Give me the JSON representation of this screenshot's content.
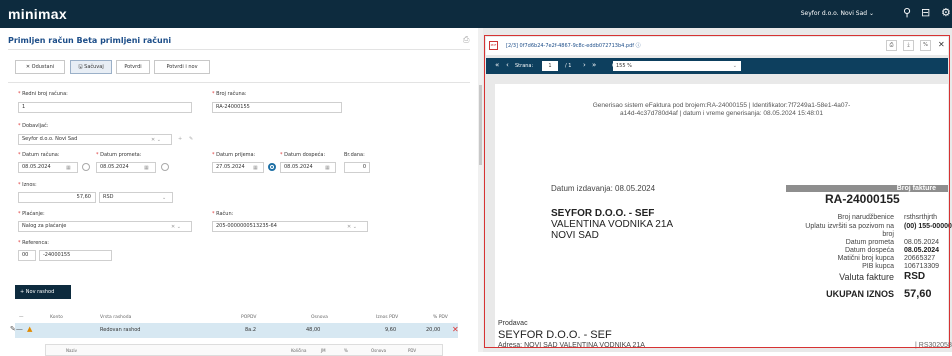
{
  "topbar": {
    "logo": "minimax",
    "company": "Seyfor d.o.o. Novi Sad ⌄"
  },
  "page": {
    "title": "Primljen račun Beta primljeni računi"
  },
  "toolbar": {
    "cancel": "Odustani",
    "save": "Sačuvaj",
    "confirm": "Potvrdi",
    "confirm_new": "Potvrdi i nov"
  },
  "form": {
    "redni_broj_label": "Redni broj računa:",
    "redni_broj": "1",
    "broj_racuna_label": "Broj računa:",
    "broj_racuna": "RA-24000155",
    "dobavljac_label": "Dobavljač:",
    "dobavljac": "Seyfor d.o.o. Novi Sad",
    "datum_racuna_label": "Datum računa:",
    "datum_racuna": "08.05.2024",
    "datum_prometa_label": "Datum prometa:",
    "datum_prometa": "08.05.2024",
    "datum_prijema_label": "Datum prijema:",
    "datum_prijema": "27.05.2024",
    "datum_dospeca_label": "Datum dospeća:",
    "datum_dospeca": "08.05.2024",
    "br_dana_label": "Br.dana:",
    "br_dana": "0",
    "iznos_label": "Iznos:",
    "iznos": "57,60",
    "valuta": "RSD",
    "placanje_label": "Plaćanje:",
    "placanje": "Nalog za plaćanje",
    "racun_label": "Račun:",
    "racun": "205-0000000513235-64",
    "referenca_label": "Referenca:",
    "ref_model": "00",
    "ref_broj": "-24000155"
  },
  "new_expense": "+ Nov rashod",
  "table": {
    "headers": [
      "Konto",
      "Vrsta rashoda",
      "POPDV",
      "Osnova",
      "Iznos PDV",
      "% PDV"
    ],
    "row": {
      "vrsta": "Redovan rashod",
      "popdv": "8a.2",
      "osnova": "48,00",
      "pdv": "9,60",
      "procenat": "20,00"
    },
    "sub_headers": [
      "Naziv",
      "Količina",
      "JM",
      "%",
      "Osnova",
      "PDV"
    ]
  },
  "pdf": {
    "filename": "[2/3] 0f7d6b24-7e2f-4867-9c8c-eddb072713b4.pdf",
    "page_label": "Strana:",
    "page_current": "1",
    "page_total": "/ 1",
    "zoom": "155 %",
    "gen_line1": "Generisao sistem eFaktura pod brojem:RA-24000155 | Identifikator:7f7249a1-58e1-4a07-",
    "gen_line2": "a14d-4c37d780d4af | datum i vreme generisanja: 08.05.2024 15:48:01",
    "datum_izdavanja": "Datum izdavanja: 08.05.2024",
    "broj_fakture_label": "Broj fakture",
    "broj_fakture": "RA-24000155",
    "kupac_name": "SEYFOR D.O.O. - SEF",
    "kupac_street": "VALENTINA VODNIKA 21A",
    "kupac_city": "NOVI SAD",
    "kv": [
      {
        "k": "Broj narudžbenice",
        "v": "rsthsrthjrth"
      },
      {
        "k": "Uplatu izvršiti sa pozivom na",
        "v": "(00) 155-00000"
      },
      {
        "k": "broj",
        "v": ""
      },
      {
        "k": "Datum prometa",
        "v": "08.05.2024"
      },
      {
        "k": "Datum dospeća",
        "v": "08.05.2024"
      },
      {
        "k": "Matični broj kupca",
        "v": "20665327"
      },
      {
        "k": "PIB kupca",
        "v": "106713309"
      }
    ],
    "valuta_label": "Valuta fakture",
    "valuta": "RSD",
    "ukupan_label": "UKUPAN IZNOS",
    "ukupan": "57,60",
    "prodavac_label": "Prodavac",
    "prodavac_name": "SEYFOR D.O.O. - SEF",
    "adresa_label": "Adresa:",
    "adresa": "NOVI SAD VALENTINA VODNIKA 21A",
    "adresa_right": "| RS302058"
  }
}
